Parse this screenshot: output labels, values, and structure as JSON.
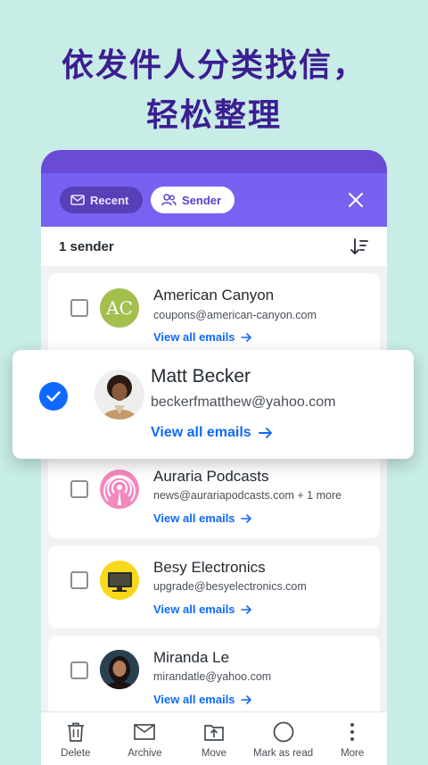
{
  "headline": {
    "line1": "依发件人分类找信，",
    "line2": "轻松整理"
  },
  "filters": {
    "recent_label": "Recent",
    "sender_label": "Sender",
    "active": "Sender"
  },
  "list_header": {
    "count_label": "1 sender"
  },
  "senders": [
    {
      "name": "American Canyon",
      "email": "coupons@american-canyon.com",
      "extra": "",
      "view_label": "View all emails",
      "avatar": "AC",
      "checked": false,
      "avatar_color": "#a3bf4e"
    },
    {
      "name": "Matt Becker",
      "email": "beckerfmatthew@yahoo.com",
      "extra": "",
      "view_label": "View all emails",
      "avatar": "photo",
      "checked": true
    },
    {
      "name": "Auraria Podcasts",
      "email": "news@aurariapodcasts.com",
      "extra": "+ 1 more",
      "view_label": "View all emails",
      "avatar": "podcast-icon",
      "checked": false,
      "avatar_color": "#f189bf"
    },
    {
      "name": "Besy Electronics",
      "email": "upgrade@besyelectronics.com",
      "extra": "",
      "view_label": "View all emails",
      "avatar": "monitor-icon",
      "checked": false,
      "avatar_color": "#f7d81a"
    },
    {
      "name": "Miranda Le",
      "email": "mirandatle@yahoo.com",
      "extra": "",
      "view_label": "View all emails",
      "avatar": "photo",
      "checked": false
    }
  ],
  "toolbar": {
    "delete_label": "Delete",
    "archive_label": "Archive",
    "move_label": "Move",
    "mark_read_label": "Mark as read",
    "more_label": "More"
  },
  "colors": {
    "background": "#c8ece6",
    "headline": "#3b1e91",
    "header_purple": "#7a62f2",
    "link_blue": "#0f69ff"
  }
}
